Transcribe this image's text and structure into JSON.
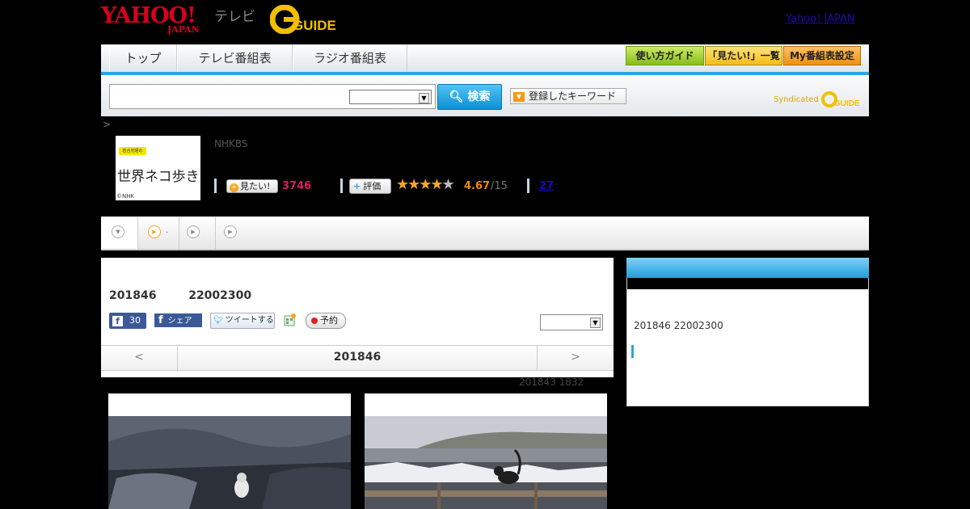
{
  "header": {
    "yahoo_logo": "YAHOO!",
    "yahoo_japan_text": "JAPAN",
    "tv_label": "テレビ",
    "guide_logo": "GUIDE",
    "yahoo_japan_link": "Yahoo! JAPAN"
  },
  "nav": {
    "tabs": [
      "トップ",
      "テレビ番組表",
      "ラジオ番組表"
    ],
    "buttons": [
      "使い方ガイド",
      "「見たい!」一覧",
      "My番組表設定"
    ]
  },
  "search": {
    "button_label": "検索",
    "keyword_button": "登録したキーワード",
    "syndicated": "Syndicated"
  },
  "breadcrumb": ">",
  "program": {
    "thumb_text": "世界ネコ歩き",
    "thumb_badge": "岩合光昭の",
    "thumb_credit": "©NHK",
    "channel": "NHKBS",
    "want_label": "見たい!",
    "want_count": "3746",
    "rate_label": "評価",
    "rating": "4.67",
    "rating_of": "/15",
    "review_count": "27",
    "stars_filled": 4.67
  },
  "main": {
    "date": "201846",
    "time": "22002300",
    "fb_count": "30",
    "fb_share": "シェア",
    "tweet": "ツイートする",
    "reserve": "予約",
    "pager_prev": "<",
    "pager_current": "201846",
    "pager_next": ">",
    "prev_broadcast": "201843  1832"
  },
  "sidebar": {
    "date_time": "201846  22002300"
  },
  "colors": {
    "accent_blue": "#29a6e3",
    "yahoo_red": "#d8001c",
    "want_pink": "#d81e5b",
    "rating_orange": "#f08a00"
  }
}
